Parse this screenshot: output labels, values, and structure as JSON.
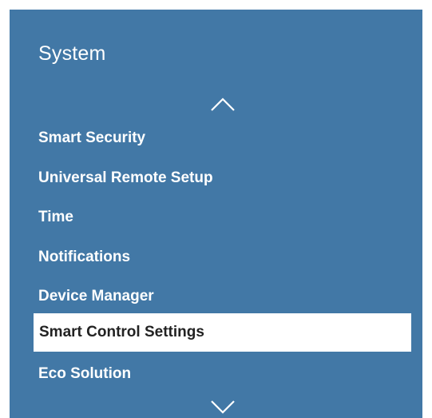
{
  "panel": {
    "title": "System",
    "scroll_up_icon": "chevron-up-icon",
    "scroll_down_icon": "chevron-down-icon",
    "background_color": "#4278a6",
    "selected_background_color": "#ffffff"
  },
  "menu": {
    "items": [
      {
        "label": "Smart Security"
      },
      {
        "label": "Universal Remote Setup"
      },
      {
        "label": "Time"
      },
      {
        "label": "Notifications"
      },
      {
        "label": "Device Manager"
      },
      {
        "label": "Smart Control Settings",
        "selected": true
      },
      {
        "label": "Eco Solution"
      }
    ]
  }
}
